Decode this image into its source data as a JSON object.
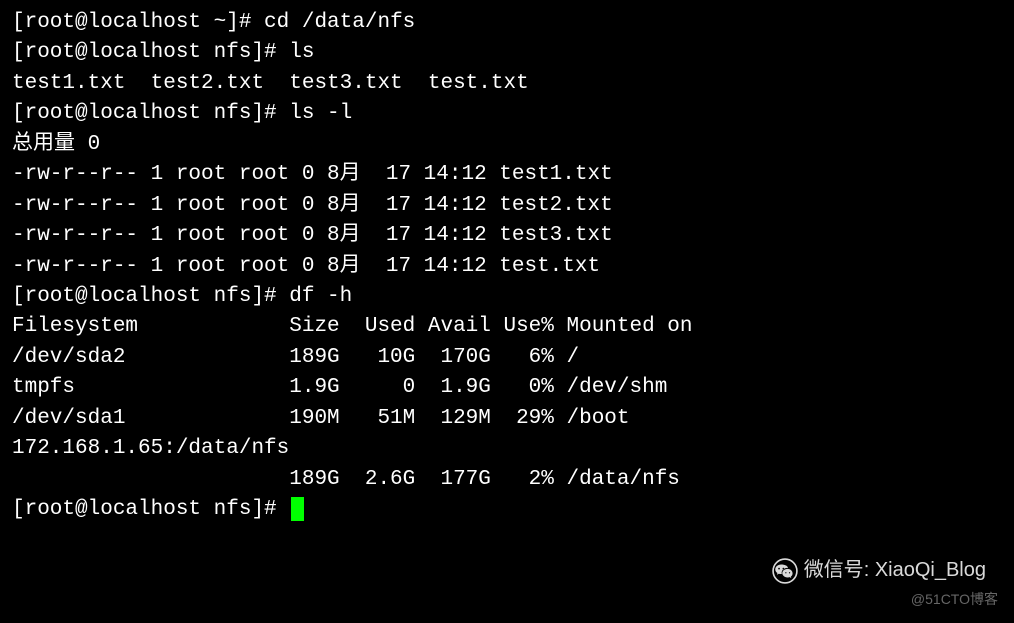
{
  "lines": [
    {
      "prompt": "[root@localhost ~]# ",
      "cmd": "cd /data/nfs"
    },
    {
      "prompt": "[root@localhost nfs]# ",
      "cmd": "ls"
    },
    {
      "out": "test1.txt  test2.txt  test3.txt  test.txt"
    },
    {
      "prompt": "[root@localhost nfs]# ",
      "cmd": "ls -l"
    },
    {
      "out": "总用量 0"
    },
    {
      "out": "-rw-r--r-- 1 root root 0 8月  17 14:12 test1.txt"
    },
    {
      "out": "-rw-r--r-- 1 root root 0 8月  17 14:12 test2.txt"
    },
    {
      "out": "-rw-r--r-- 1 root root 0 8月  17 14:12 test3.txt"
    },
    {
      "out": "-rw-r--r-- 1 root root 0 8月  17 14:12 test.txt"
    },
    {
      "prompt": "[root@localhost nfs]# ",
      "cmd": "df -h"
    },
    {
      "out": "Filesystem            Size  Used Avail Use% Mounted on"
    },
    {
      "out": "/dev/sda2             189G   10G  170G   6% /"
    },
    {
      "out": "tmpfs                 1.9G     0  1.9G   0% /dev/shm"
    },
    {
      "out": "/dev/sda1             190M   51M  129M  29% /boot"
    },
    {
      "out": "172.168.1.65:/data/nfs"
    },
    {
      "out": "                      189G  2.6G  177G   2% /data/nfs"
    },
    {
      "prompt": "[root@localhost nfs]# ",
      "cmd": "",
      "cursor": true
    }
  ],
  "watermark1_label": "微信号",
  "watermark1_value": "XiaoQi_Blog",
  "watermark2": "@51CTO博客"
}
